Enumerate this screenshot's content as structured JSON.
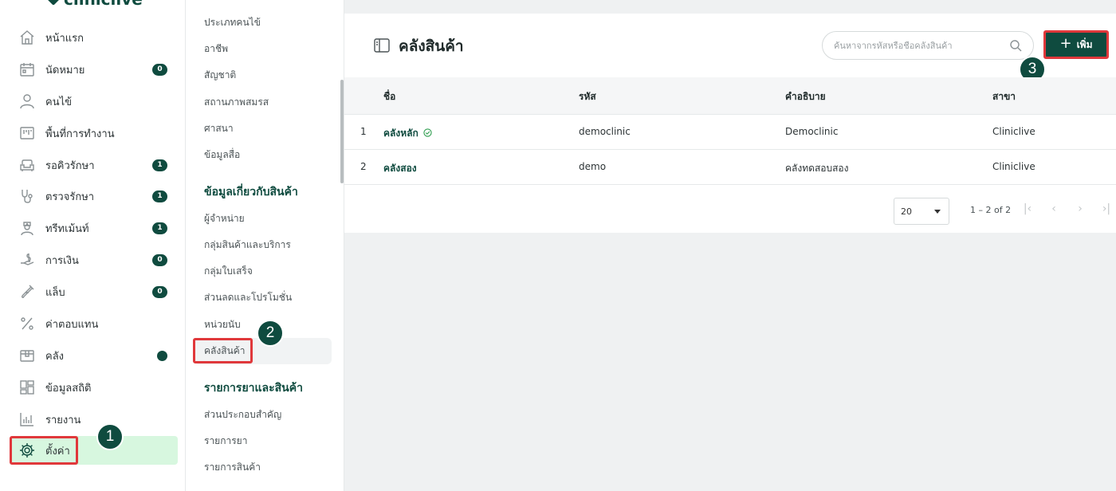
{
  "brand": {
    "name": "cliniclive"
  },
  "sidebar": {
    "items": [
      {
        "label": "หน้าแรก",
        "icon": "home-icon",
        "badge": ""
      },
      {
        "label": "นัดหมาย",
        "icon": "calendar-icon",
        "badge": "0"
      },
      {
        "label": "คนไข้",
        "icon": "user-icon",
        "badge": ""
      },
      {
        "label": "พื้นที่การทำงาน",
        "icon": "workspace-icon",
        "badge": ""
      },
      {
        "label": "รอคิวรักษา",
        "icon": "sofa-icon",
        "badge": "1"
      },
      {
        "label": "ตรวจรักษา",
        "icon": "stethoscope-icon",
        "badge": "1"
      },
      {
        "label": "ทรีทเม้นท์",
        "icon": "nurse-icon",
        "badge": "1"
      },
      {
        "label": "การเงิน",
        "icon": "money-hand-icon",
        "badge": "0"
      },
      {
        "label": "แล็บ",
        "icon": "test-tube-icon",
        "badge": "0"
      },
      {
        "label": "ค่าตอบแทน",
        "icon": "percent-icon",
        "badge": ""
      },
      {
        "label": "คลัง",
        "icon": "box-icon",
        "badge": "dot"
      },
      {
        "label": "ข้อมูลสถิติ",
        "icon": "dashboard-icon",
        "badge": ""
      },
      {
        "label": "รายงาน",
        "icon": "bar-chart-icon",
        "badge": ""
      },
      {
        "label": "ตั้งค่า",
        "icon": "gear-icon",
        "badge": ""
      }
    ]
  },
  "submenu": {
    "group1_items": [
      "ประเภทคนไข้",
      "อาชีพ",
      "สัญชาติ",
      "สถานภาพสมรส",
      "ศาสนา",
      "ข้อมูลสื่อ"
    ],
    "group2_title": "ข้อมูลเกี่ยวกับสินค้า",
    "group2_items": [
      "ผู้จำหน่าย",
      "กลุ่มสินค้าและบริการ",
      "กลุ่มใบเสร็จ",
      "ส่วนลดและโปรโมชั่น",
      "หน่วยนับ",
      "คลังสินค้า"
    ],
    "group3_title": "รายการยาและสินค้า",
    "group3_items": [
      "ส่วนประกอบสำคัญ",
      "รายการยา",
      "รายการสินค้า"
    ]
  },
  "page": {
    "title": "คลังสินค้า",
    "search_placeholder": "ค้นหาจากรหัสหรือชื่อคลังสินค้า",
    "add_label": "เพิ่ม"
  },
  "table": {
    "columns": [
      "ชื่อ",
      "รหัส",
      "คำอธิบาย",
      "สาขา"
    ],
    "rows": [
      {
        "index": "1",
        "name": "คลังหลัก",
        "code": "democlinic",
        "description": "Democlinic",
        "branch": "Cliniclive",
        "default": true
      },
      {
        "index": "2",
        "name": "คลังสอง",
        "code": "demo",
        "description": "คลังทดสอบสอง",
        "branch": "Cliniclive",
        "default": false
      }
    ],
    "page_size": "20",
    "range_text": "1 – 2 of 2"
  },
  "steps": [
    "1",
    "2",
    "3"
  ],
  "colors": {
    "brand": "#0f4b3f",
    "highlight": "#e0383b",
    "active_bg": "#d7f7df"
  }
}
